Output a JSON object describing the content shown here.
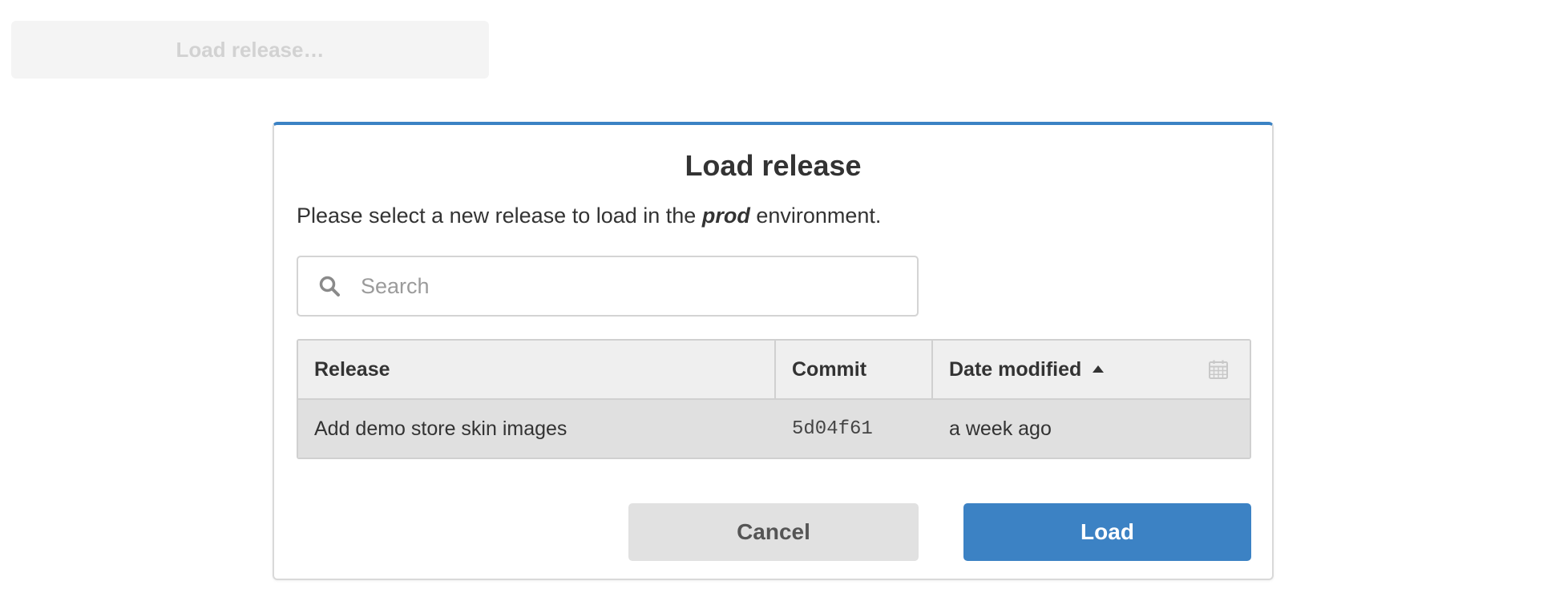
{
  "background_button": {
    "label": "Load release…"
  },
  "modal": {
    "title": "Load release",
    "description_prefix": "Please select a new release to load in the ",
    "environment": "prod",
    "description_suffix": " environment.",
    "search": {
      "placeholder": "Search",
      "value": ""
    },
    "table": {
      "columns": [
        "Release",
        "Commit",
        "Date modified"
      ],
      "sorted_column": "Date modified",
      "sort_direction": "ascending",
      "rows": [
        {
          "release": "Add demo store skin images",
          "commit": "5d04f61",
          "date_modified": "a week ago"
        }
      ]
    },
    "buttons": {
      "cancel": "Cancel",
      "load": "Load"
    }
  },
  "colors": {
    "accent": "#3c82c4",
    "selected_row": "#e0e0e0",
    "header_row": "#efefef"
  },
  "icons": {
    "search": "search-icon",
    "calendar": "calendar-icon",
    "sort": "sort-ascending-icon"
  }
}
